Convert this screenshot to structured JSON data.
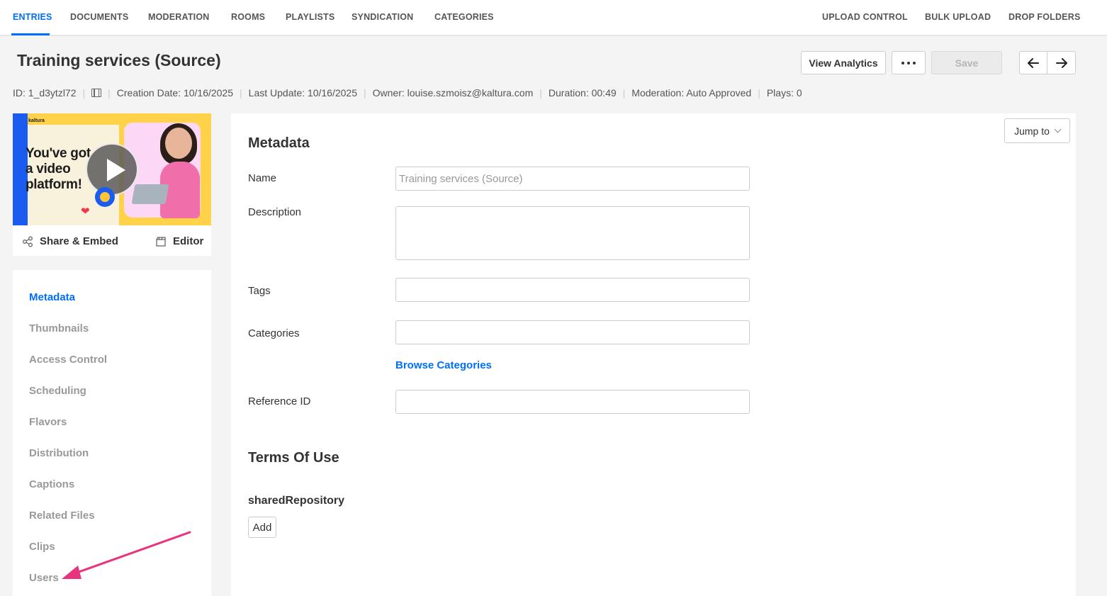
{
  "nav": {
    "left": [
      "ENTRIES",
      "DOCUMENTS",
      "MODERATION",
      "ROOMS",
      "PLAYLISTS",
      "SYNDICATION",
      "CATEGORIES"
    ],
    "right": [
      "UPLOAD CONTROL",
      "BULK UPLOAD",
      "DROP FOLDERS"
    ],
    "active": "ENTRIES"
  },
  "header": {
    "title": "Training services (Source)",
    "view_analytics": "View Analytics",
    "save": "Save"
  },
  "meta": {
    "id": "ID: 1_d3ytzl72",
    "creation_date": "Creation Date: 10/16/2025",
    "last_update": "Last Update: 10/16/2025",
    "owner": "Owner: louise.szmoisz@kaltura.com",
    "duration": "Duration: 00:49",
    "moderation": "Moderation: Auto Approved",
    "plays": "Plays: 0"
  },
  "thumbnail": {
    "logo": "kaltura",
    "headline_1": "You've got",
    "headline_2": "a video",
    "headline_3": "platform!",
    "share_embed": "Share & Embed",
    "editor": "Editor"
  },
  "side_menu": {
    "items": [
      "Metadata",
      "Thumbnails",
      "Access Control",
      "Scheduling",
      "Flavors",
      "Distribution",
      "Captions",
      "Related Files",
      "Clips",
      "Users"
    ],
    "active": "Metadata"
  },
  "main": {
    "jump_to": "Jump to",
    "metadata_title": "Metadata",
    "name_label": "Name",
    "name_value": "Training services (Source)",
    "description_label": "Description",
    "tags_label": "Tags",
    "categories_label": "Categories",
    "browse_categories": "Browse Categories",
    "reference_id_label": "Reference ID",
    "terms_title": "Terms Of Use",
    "shared_repository": "sharedRepository",
    "add": "Add"
  },
  "colors": {
    "accent": "#006efa",
    "annotation_arrow": "#e8337e"
  }
}
